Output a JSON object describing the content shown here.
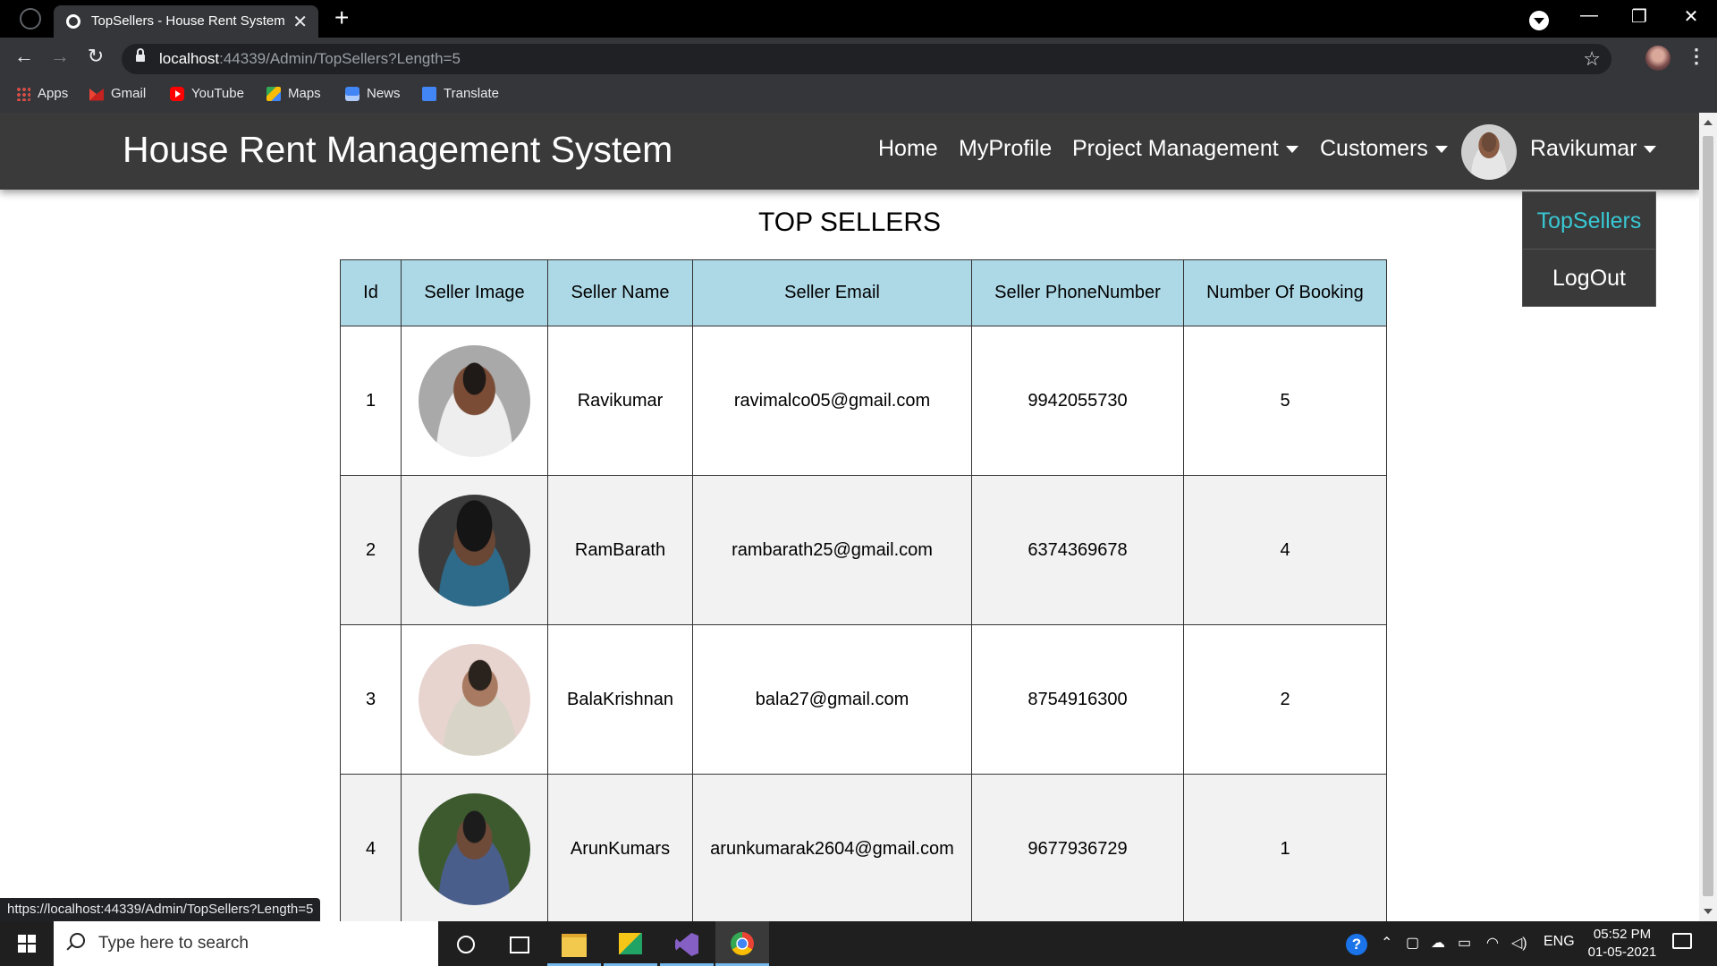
{
  "browser": {
    "tab_title": "TopSellers - House Rent System",
    "tab_close": "✕",
    "new_tab": "+",
    "url_host": "localhost",
    "url_path": ":44339/Admin/TopSellers?Length=5",
    "bookmarks": [
      "Apps",
      "Gmail",
      "YouTube",
      "Maps",
      "News",
      "Translate"
    ],
    "status_url": "https://localhost:44339/Admin/TopSellers?Length=5",
    "window_controls": {
      "minimize": "—",
      "restore": "❐",
      "close": "✕"
    }
  },
  "site": {
    "brand": "House Rent Management System",
    "nav": {
      "home": "Home",
      "profile": "MyProfile",
      "project_management": "Project Management",
      "customers": "Customers",
      "user": "Ravikumar"
    },
    "user_menu": {
      "items": [
        "TopSellers",
        "LogOut"
      ]
    },
    "page_title": "TOP SELLERS",
    "accent_color": "#38c8d4",
    "header_color": "#add8e6"
  },
  "table": {
    "headers": [
      "Id",
      "Seller Image",
      "Seller Name",
      "Seller Email",
      "Seller PhoneNumber",
      "Number Of Booking"
    ],
    "rows": [
      {
        "id": "1",
        "name": "Ravikumar",
        "email": "ravimalco05@gmail.com",
        "phone": "9942055730",
        "bookings": "5"
      },
      {
        "id": "2",
        "name": "RamBarath",
        "email": "rambarath25@gmail.com",
        "phone": "6374369678",
        "bookings": "4"
      },
      {
        "id": "3",
        "name": "BalaKrishnan",
        "email": "bala27@gmail.com",
        "phone": "8754916300",
        "bookings": "2"
      },
      {
        "id": "4",
        "name": "ArunKumars",
        "email": "arunkumarak2604@gmail.com",
        "phone": "9677936729",
        "bookings": "1"
      }
    ]
  },
  "taskbar": {
    "search_placeholder": "Type here to search",
    "language": "ENG",
    "time": "05:52 PM",
    "date": "01-05-2021",
    "help": "?"
  }
}
